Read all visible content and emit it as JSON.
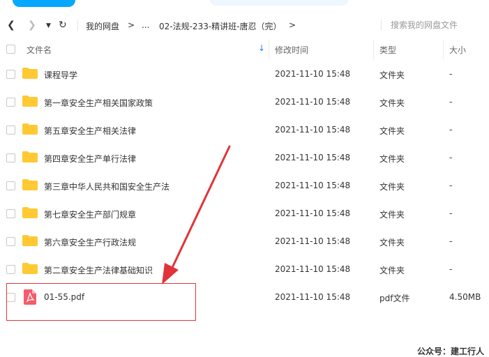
{
  "nav": {
    "breadcrumb": [
      "我的网盘",
      "...",
      "02-法规-233-精讲班-唐忍（完）"
    ],
    "arrow": ">",
    "search_placeholder": "搜索我的网盘文件"
  },
  "columns": {
    "name": "文件名",
    "modified": "修改时间",
    "type": "类型",
    "size": "大小"
  },
  "files": [
    {
      "name": "课程导学",
      "modified": "2021-11-10 15:48",
      "type": "文件夹",
      "size": "-",
      "icon": "folder-icon"
    },
    {
      "name": "第一章安全生产相关国家政策",
      "modified": "2021-11-10 15:48",
      "type": "文件夹",
      "size": "-",
      "icon": "folder-icon"
    },
    {
      "name": "第五章安全生产相关法律",
      "modified": "2021-11-10 15:48",
      "type": "文件夹",
      "size": "-",
      "icon": "folder-icon"
    },
    {
      "name": "第四章安全生产单行法律",
      "modified": "2021-11-10 15:48",
      "type": "文件夹",
      "size": "-",
      "icon": "folder-icon"
    },
    {
      "name": "第三章中华人民共和国安全生产法",
      "modified": "2021-11-10 15:48",
      "type": "文件夹",
      "size": "-",
      "icon": "folder-icon"
    },
    {
      "name": "第七章安全生产部门规章",
      "modified": "2021-11-10 15:48",
      "type": "文件夹",
      "size": "-",
      "icon": "folder-icon"
    },
    {
      "name": "第六章安全生产行政法规",
      "modified": "2021-11-10 15:48",
      "type": "文件夹",
      "size": "-",
      "icon": "folder-icon"
    },
    {
      "name": "第二章安全生产法律基础知识",
      "modified": "2021-11-10 15:48",
      "type": "文件夹",
      "size": "-",
      "icon": "folder-icon"
    },
    {
      "name": "01-55.pdf",
      "modified": "2021-11-10 15:48",
      "type": "pdf文件",
      "size": "4.50MB",
      "icon": "pdf-icon"
    }
  ],
  "watermark": "公众号：建工行人",
  "colors": {
    "accent": "#06a7ff",
    "folder": "#ffc933",
    "pdf": "#f55c6b",
    "annotation": "#e0343a"
  }
}
